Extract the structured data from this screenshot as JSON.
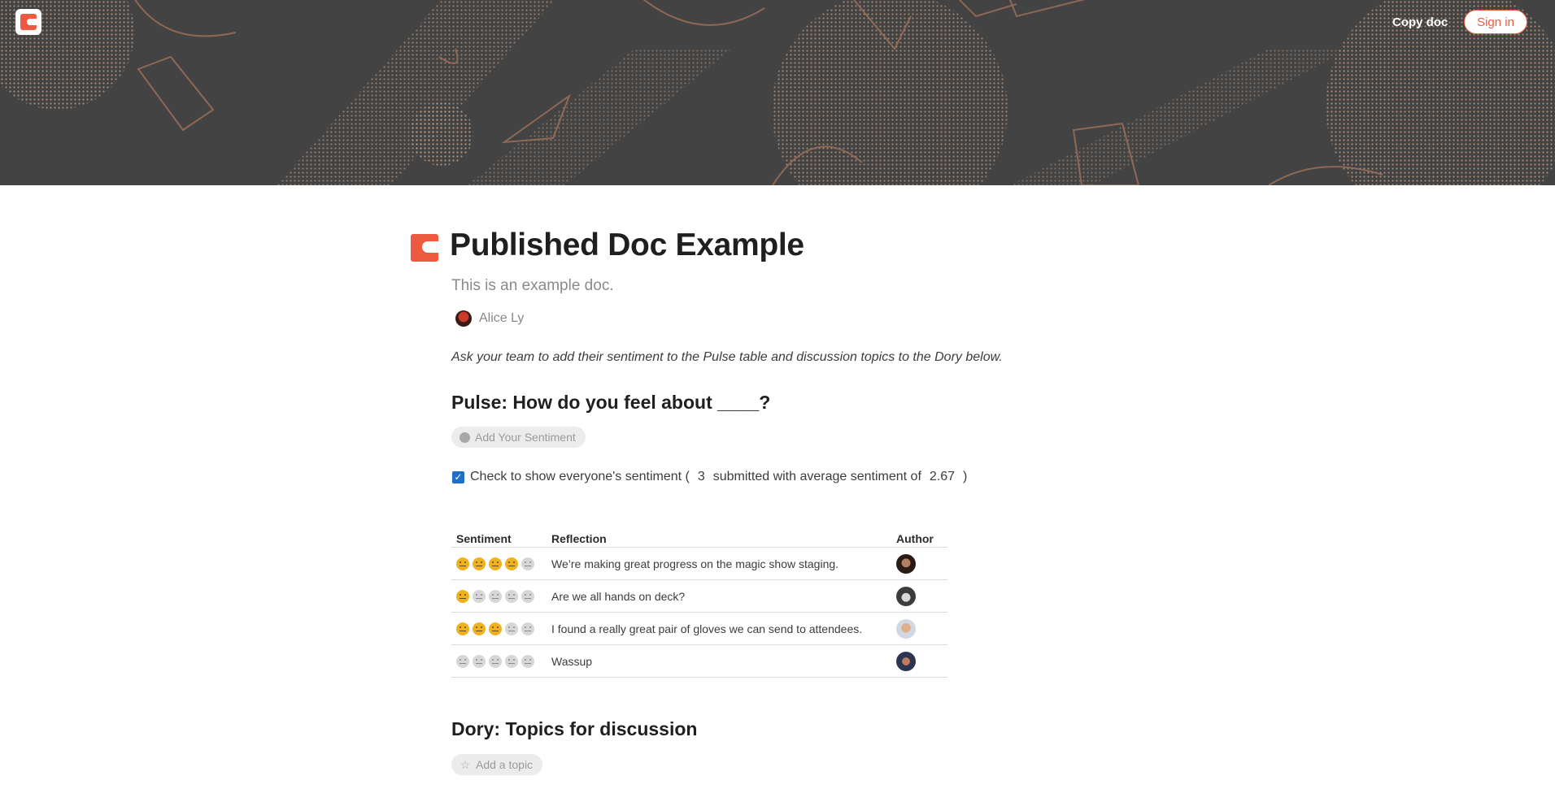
{
  "topbar": {
    "copy_doc_label": "Copy doc",
    "sign_in_label": "Sign in",
    "accent": "#ee5a3f"
  },
  "doc": {
    "title": "Published Doc Example",
    "subtitle": "This is an example doc.",
    "author": "Alice Ly",
    "intro": "Ask your team to add their sentiment to the Pulse table and discussion topics to the Dory below."
  },
  "pulse": {
    "heading": "Pulse: How do you feel about ____?",
    "add_button": "Add Your Sentiment",
    "checkbox_checked": true,
    "check_label": "Check to show everyone's sentiment (",
    "submitted_count": "3",
    "submitted_text": "submitted with average sentiment of",
    "average": "2.67",
    "close_paren": ")",
    "columns": [
      "Sentiment",
      "Reflection",
      "Author"
    ],
    "rows": [
      {
        "sentiment": 4,
        "reflection": "We’re making great progress on the magic show staging.",
        "author_avatar": "avatar-1"
      },
      {
        "sentiment": 1,
        "reflection": "Are we all hands on deck?",
        "author_avatar": "avatar-2"
      },
      {
        "sentiment": 3,
        "reflection": "I found a really great pair of gloves we can send to attendees.",
        "author_avatar": "avatar-3"
      },
      {
        "sentiment": 0,
        "reflection": "Wassup",
        "author_avatar": "avatar-4"
      }
    ]
  },
  "dory": {
    "heading": "Dory: Topics for discussion",
    "add_button": "Add a topic"
  }
}
